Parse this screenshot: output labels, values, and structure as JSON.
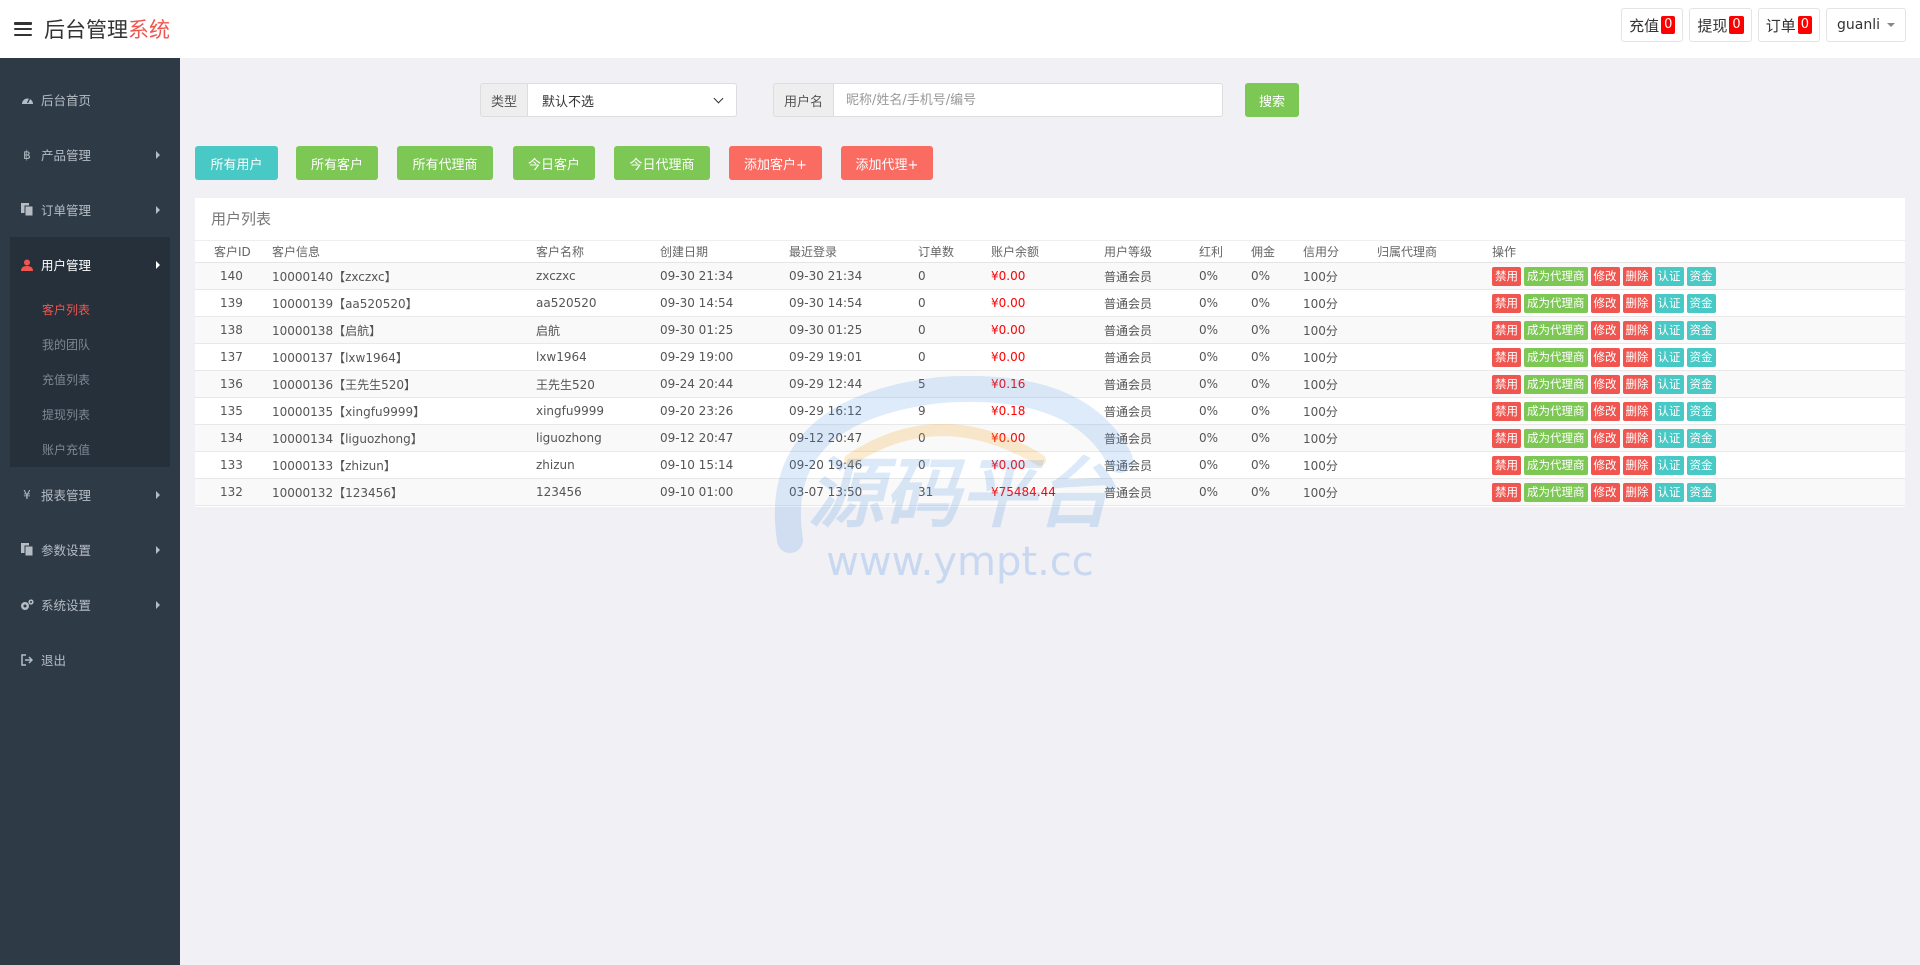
{
  "header": {
    "brand_main": "后台管理",
    "brand_accent": "系统",
    "recharge_label": "充值",
    "recharge_count": "0",
    "withdraw_label": "提现",
    "withdraw_count": "0",
    "order_label": "订单",
    "order_count": "0",
    "username": "guanli"
  },
  "sidebar": {
    "items": [
      {
        "label": "后台首页",
        "icon": "dashboard-icon"
      },
      {
        "label": "产品管理",
        "icon": "bitcoin-icon"
      },
      {
        "label": "订单管理",
        "icon": "copy-icon"
      },
      {
        "label": "用户管理",
        "icon": "user-icon"
      },
      {
        "label": "报表管理",
        "icon": "yen-icon"
      },
      {
        "label": "参数设置",
        "icon": "copy-icon"
      },
      {
        "label": "系统设置",
        "icon": "gears-icon"
      },
      {
        "label": "退出",
        "icon": "sign-out-icon"
      }
    ],
    "sub_items": [
      "客户列表",
      "我的团队",
      "充值列表",
      "提现列表",
      "账户充值"
    ]
  },
  "search": {
    "type_label": "类型",
    "type_value": "默认不选",
    "user_label": "用户名",
    "user_placeholder": "昵称/姓名/手机号/编号",
    "search_button": "搜索"
  },
  "filters": {
    "all_users": "所有用户",
    "all_customers": "所有客户",
    "all_agents": "所有代理商",
    "today_customers": "今日客户",
    "today_agents": "今日代理商",
    "add_customer": "添加客户+",
    "add_agent": "添加代理+"
  },
  "table": {
    "title": "用户列表",
    "columns": [
      "客户ID",
      "客户信息",
      "客户名称",
      "创建日期",
      "最近登录",
      "订单数",
      "账户余额",
      "用户等级",
      "红利",
      "佣金",
      "信用分",
      "归属代理商",
      "操作"
    ],
    "rows": [
      [
        "140",
        "10000140【zxczxc】",
        "zxczxc",
        "09-30 21:34",
        "09-30 21:34",
        "0",
        "¥0.00",
        "普通会员",
        "0%",
        "0%",
        "100分",
        ""
      ],
      [
        "139",
        "10000139【aa520520】",
        "aa520520",
        "09-30 14:54",
        "09-30 14:54",
        "0",
        "¥0.00",
        "普通会员",
        "0%",
        "0%",
        "100分",
        ""
      ],
      [
        "138",
        "10000138【启航】",
        "启航",
        "09-30 01:25",
        "09-30 01:25",
        "0",
        "¥0.00",
        "普通会员",
        "0%",
        "0%",
        "100分",
        ""
      ],
      [
        "137",
        "10000137【lxw1964】",
        "lxw1964",
        "09-29 19:00",
        "09-29 19:01",
        "0",
        "¥0.00",
        "普通会员",
        "0%",
        "0%",
        "100分",
        ""
      ],
      [
        "136",
        "10000136【王先生520】",
        "王先生520",
        "09-24 20:44",
        "09-29 12:44",
        "5",
        "¥0.16",
        "普通会员",
        "0%",
        "0%",
        "100分",
        ""
      ],
      [
        "135",
        "10000135【xingfu9999】",
        "xingfu9999",
        "09-20 23:26",
        "09-29 16:12",
        "9",
        "¥0.18",
        "普通会员",
        "0%",
        "0%",
        "100分",
        ""
      ],
      [
        "134",
        "10000134【liguozhong】",
        "liguozhong",
        "09-12 20:47",
        "09-12 20:47",
        "0",
        "¥0.00",
        "普通会员",
        "0%",
        "0%",
        "100分",
        ""
      ],
      [
        "133",
        "10000133【zhizun】",
        "zhizun",
        "09-10 15:14",
        "09-20 19:46",
        "0",
        "¥0.00",
        "普通会员",
        "0%",
        "0%",
        "100分",
        ""
      ],
      [
        "132",
        "10000132【123456】",
        "123456",
        "09-10 01:00",
        "03-07 13:50",
        "31",
        "¥75484.44",
        "普通会员",
        "0%",
        "0%",
        "100分",
        ""
      ]
    ],
    "actions": [
      {
        "label": "禁用",
        "color": "#f0564f"
      },
      {
        "label": "成为代理商",
        "color": "#7dc855"
      },
      {
        "label": "修改",
        "color": "#f0564f"
      },
      {
        "label": "删除",
        "color": "#f0564f"
      },
      {
        "label": "认证",
        "color": "#48c9c5"
      },
      {
        "label": "资金",
        "color": "#48c9c5"
      }
    ]
  },
  "watermark": {
    "title": "源码平台",
    "url": "www.ympt.cc"
  },
  "colors": {
    "accent_red": "#f0564f",
    "green": "#7dc855",
    "teal": "#48c9c5",
    "sidebar_bg": "#2f3a47"
  }
}
